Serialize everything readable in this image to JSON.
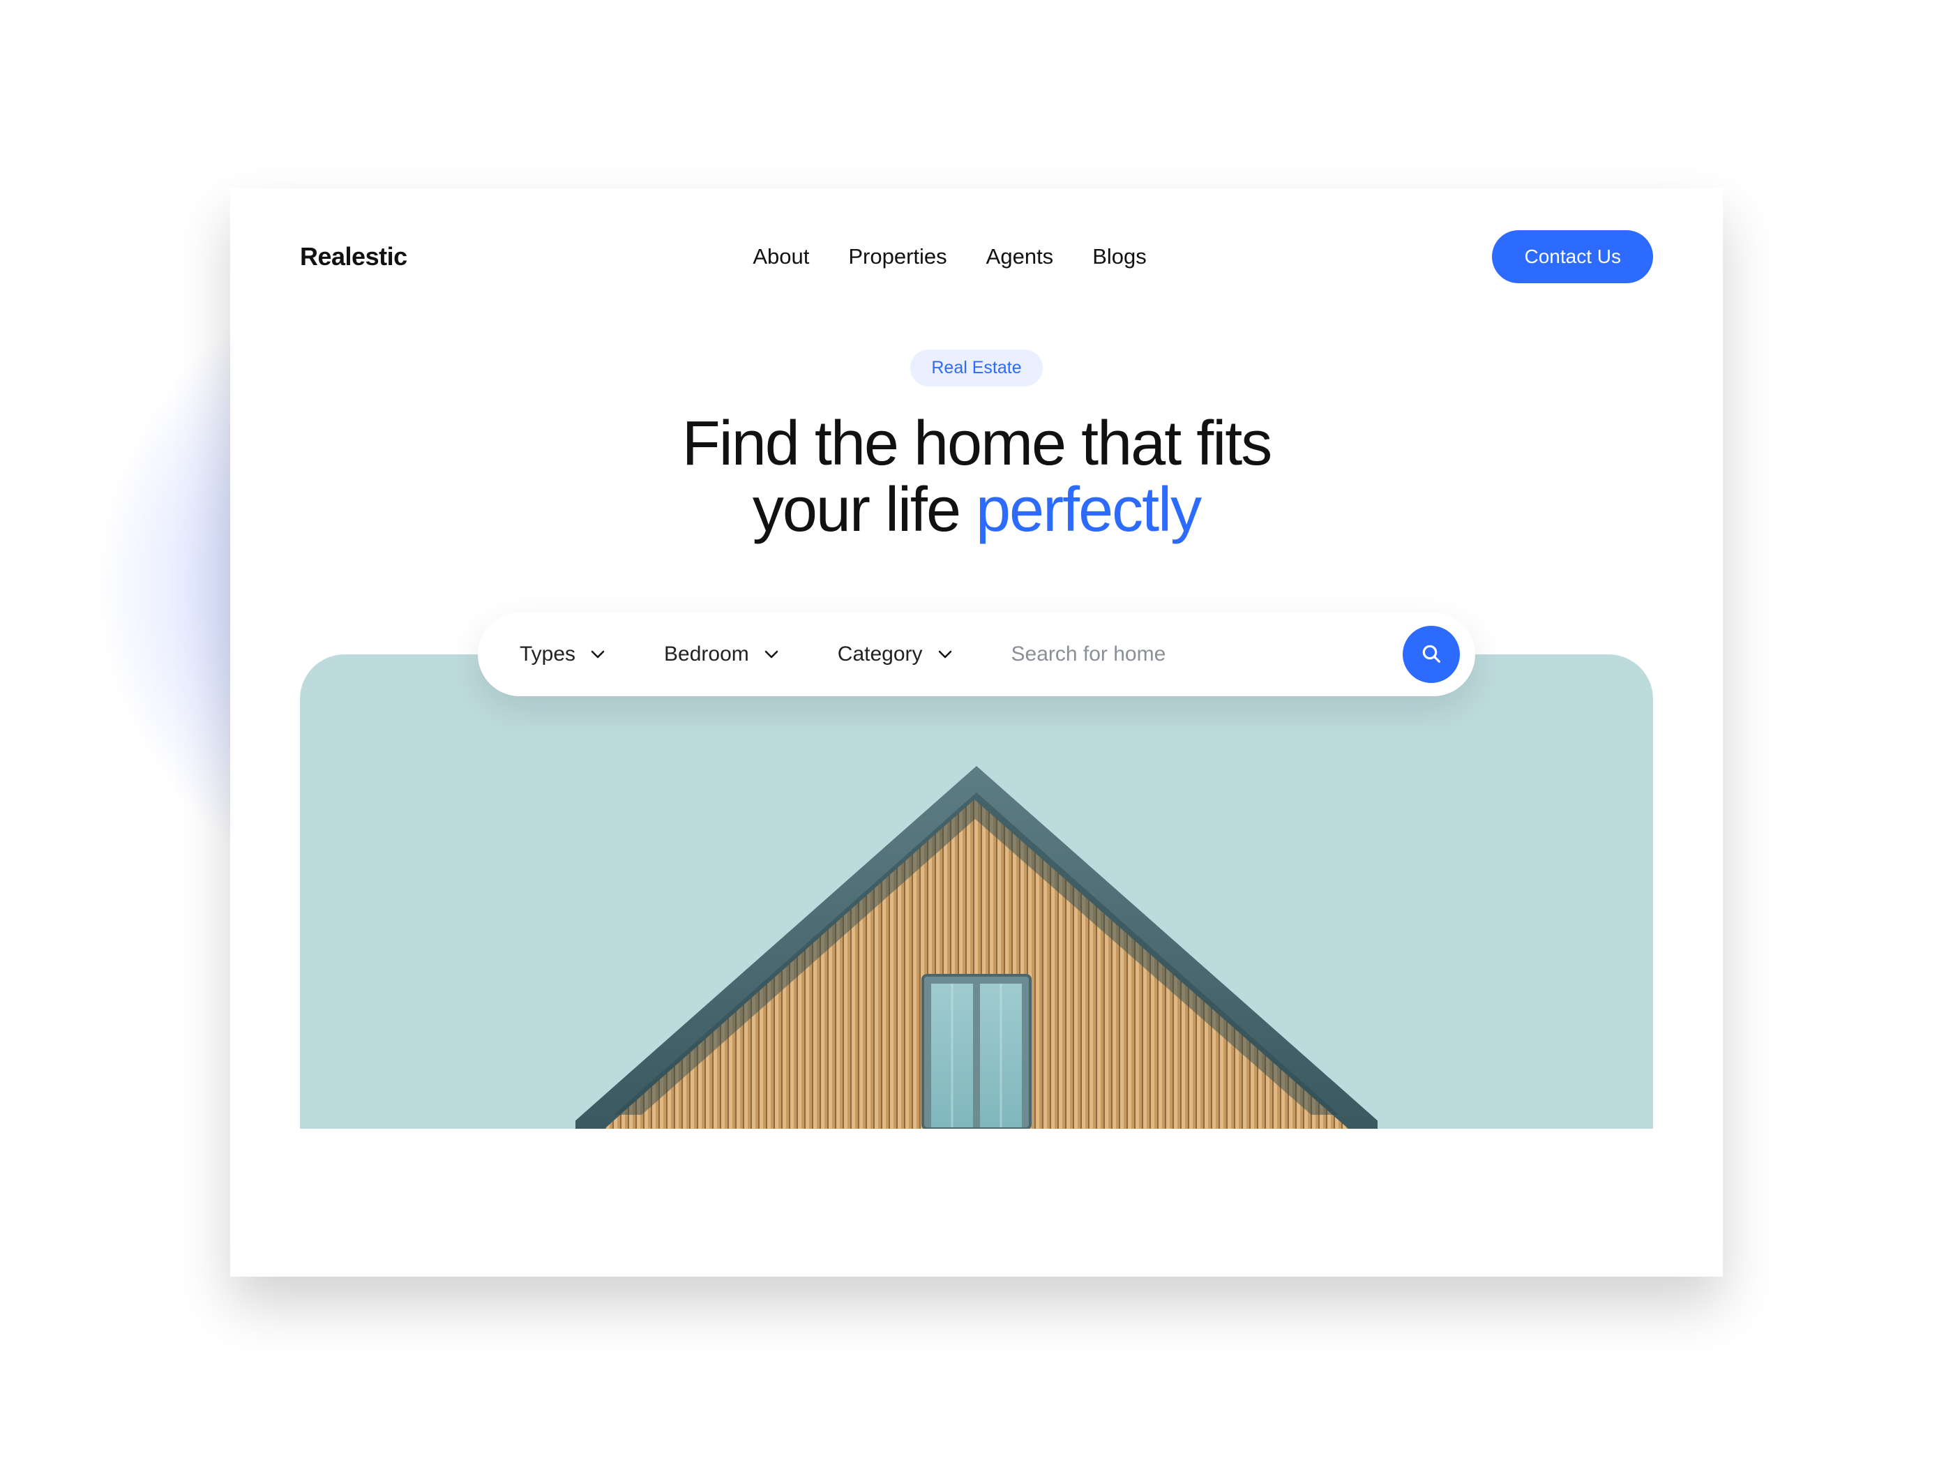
{
  "header": {
    "brand": "Realestic",
    "nav": {
      "about": "About",
      "properties": "Properties",
      "agents": "Agents",
      "blogs": "Blogs"
    },
    "contact_label": "Contact Us"
  },
  "hero": {
    "pill": "Real Estate",
    "headline_part1": "Find the home that fits",
    "headline_part2a": "your life ",
    "headline_accent": "perfectly"
  },
  "search": {
    "types_label": "Types",
    "bedroom_label": "Bedroom",
    "category_label": "Category",
    "placeholder": "Search for home"
  },
  "colors": {
    "accent": "#2d6bff",
    "pill_bg": "#eaf0ff",
    "sky": "#bddadd"
  }
}
